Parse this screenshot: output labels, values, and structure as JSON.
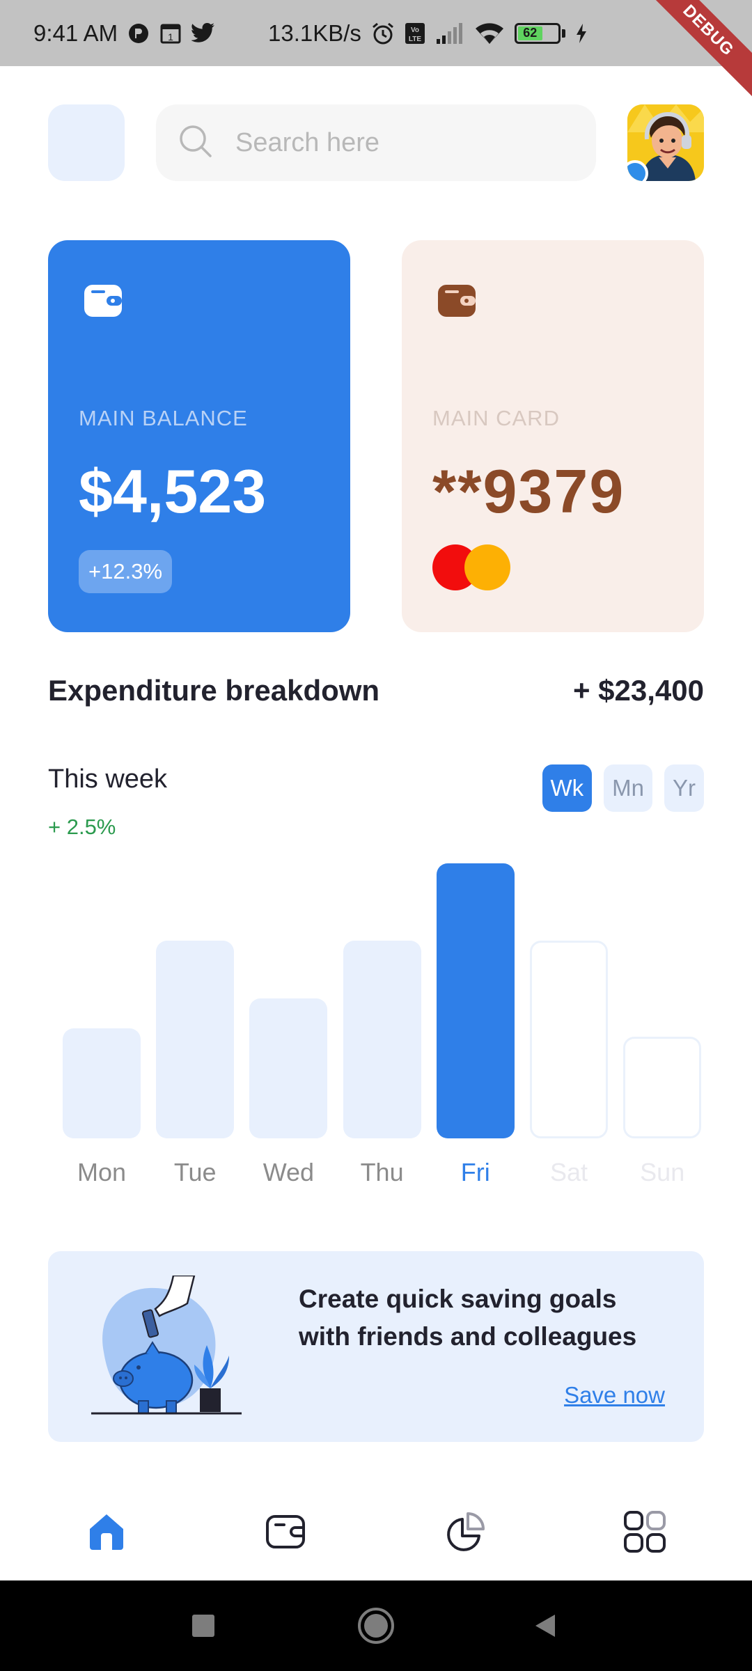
{
  "status_bar": {
    "time": "9:41 AM",
    "network_speed": "13.1KB/s",
    "battery_level": "62",
    "battery_fraction": 0.62,
    "debug_label": "DEBUG",
    "icons": [
      "notification-icon",
      "calendar-icon",
      "twitter-icon",
      "alarm-icon",
      "volte-icon",
      "signal-icon",
      "wifi-icon",
      "battery-icon",
      "charging-icon"
    ]
  },
  "header": {
    "search_placeholder": "Search here",
    "icons": [
      "menu-tile",
      "search-icon",
      "avatar"
    ]
  },
  "cards": {
    "balance": {
      "label": "MAIN BALANCE",
      "amount": "$4,523",
      "change": "+12.3%",
      "icon": "wallet-icon",
      "color": "#2f7fe8"
    },
    "main_card": {
      "label": "MAIN CARD",
      "number": "**9379",
      "icon": "wallet-icon",
      "brand_icon": "mastercard-icon",
      "color": "#f9eee9"
    }
  },
  "expenditure": {
    "title": "Expenditure breakdown",
    "total": "+ $23,400",
    "period_label": "This week",
    "period_change": "+ 2.5%",
    "tabs": [
      {
        "label": "Wk",
        "active": true
      },
      {
        "label": "Mn",
        "active": false
      },
      {
        "label": "Yr",
        "active": false
      }
    ]
  },
  "chart_data": {
    "type": "bar",
    "categories": [
      "Mon",
      "Tue",
      "Wed",
      "Thu",
      "Fri",
      "Sat",
      "Sun"
    ],
    "values": [
      40,
      72,
      51,
      72,
      100,
      72,
      37
    ],
    "highlighted": "Fri",
    "muted": [
      "Sat",
      "Sun"
    ],
    "ylim": [
      0,
      100
    ],
    "colors": {
      "bar": "#e8f0fd",
      "active": "#2f7fe8",
      "outline": "#eaf1fb"
    }
  },
  "promo": {
    "text": "Create quick saving goals with friends and colleagues",
    "link": "Save now",
    "illustration": "piggy-bank-illustration"
  },
  "bottom_nav": {
    "items": [
      {
        "name": "home",
        "icon": "home-icon",
        "active": true
      },
      {
        "name": "wallet",
        "icon": "wallet-icon",
        "active": false
      },
      {
        "name": "analytics",
        "icon": "pie-chart-icon",
        "active": false
      },
      {
        "name": "more",
        "icon": "grid-icon",
        "active": false
      }
    ]
  },
  "system_nav": {
    "icons": [
      "recents-icon",
      "home-button-icon",
      "back-icon"
    ]
  },
  "colors": {
    "accent": "#2f7fe8",
    "positive": "#2b9a4e",
    "card_brown": "#8b4a28"
  }
}
